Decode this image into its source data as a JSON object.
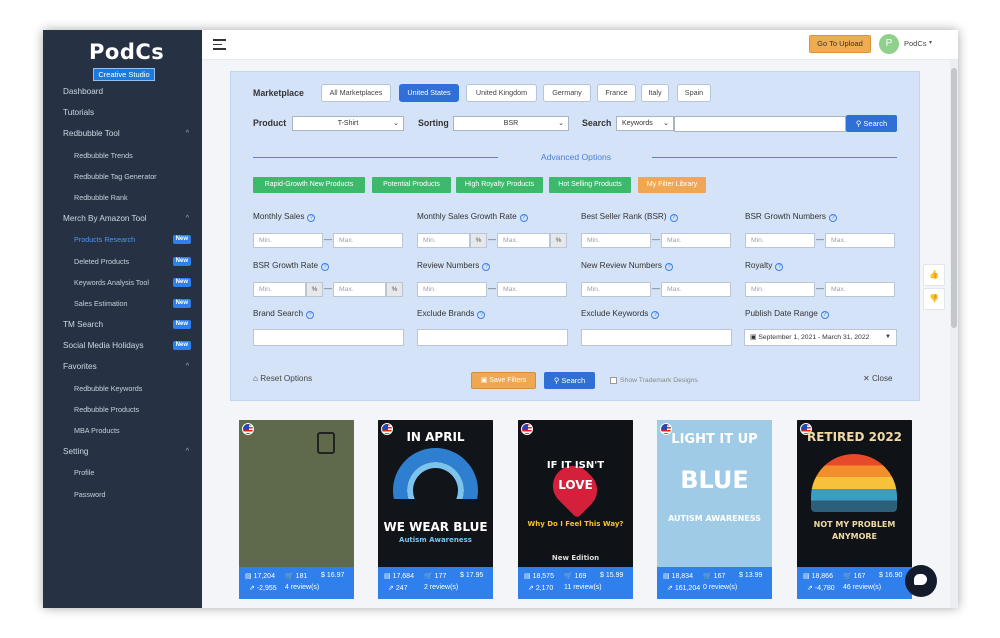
{
  "brand": {
    "title": "PodCs",
    "subtitle": "Creative Studio"
  },
  "sidebar": {
    "items": [
      {
        "label": "Dashboard",
        "level": "top"
      },
      {
        "label": "Tutorials",
        "level": "top"
      },
      {
        "label": "Redbubble Tool",
        "level": "top",
        "chevron": "^"
      },
      {
        "label": "Redbubble Trends",
        "level": "sub"
      },
      {
        "label": "Redbubble Tag Generator",
        "level": "sub"
      },
      {
        "label": "Redbubble Rank",
        "level": "sub"
      },
      {
        "label": "Merch By Amazon Tool",
        "level": "top",
        "chevron": "^"
      },
      {
        "label": "Products Research",
        "level": "sub",
        "badge": "New",
        "active": true
      },
      {
        "label": "Deleted Products",
        "level": "sub",
        "badge": "New"
      },
      {
        "label": "Keywords Analysis Tool",
        "level": "sub",
        "badge": "New"
      },
      {
        "label": "Sales Estimation",
        "level": "sub",
        "badge": "New"
      },
      {
        "label": "TM Search",
        "level": "top",
        "badge": "New"
      },
      {
        "label": "Social Media Holidays",
        "level": "top",
        "badge": "New"
      },
      {
        "label": "Favorites",
        "level": "top",
        "chevron": "^"
      },
      {
        "label": "Redbubble Keywords",
        "level": "sub"
      },
      {
        "label": "Redbubble Products",
        "level": "sub"
      },
      {
        "label": "MBA Products",
        "level": "sub"
      },
      {
        "label": "Setting",
        "level": "top",
        "chevron": "^"
      },
      {
        "label": "Profile",
        "level": "sub"
      },
      {
        "label": "Password",
        "level": "sub"
      }
    ]
  },
  "header": {
    "upload_label": "Go To Upload",
    "avatar_letter": "P",
    "user_name": "PodCs",
    "user_caret": "▾"
  },
  "filters": {
    "marketplace_label": "Marketplace",
    "marketplaces": [
      "All Marketplaces",
      "United States",
      "United Kingdom",
      "Germany",
      "France",
      "Italy",
      "Spain"
    ],
    "active_marketplace": "United States",
    "product_label": "Product",
    "product_value": "T-Shirt",
    "sorting_label": "Sorting",
    "sorting_value": "BSR",
    "search_label": "Search",
    "search_type": "Keywords",
    "search_button": "Search",
    "advanced_label": "Advanced Options",
    "quick_tags": [
      "Rapid-Growth New Products",
      "Potential Products",
      "High Royalty Products",
      "Hot Selling Products",
      "My Filter Library"
    ],
    "min_placeholder": "Min.",
    "max_placeholder": "Max.",
    "percent": "%",
    "range_sep": "—",
    "fields": {
      "monthly_sales": "Monthly Sales",
      "monthly_sales_growth": "Monthly Sales Growth Rate",
      "bsr": "Best Seller Rank (BSR)",
      "bsr_growth_numbers": "BSR Growth Numbers",
      "bsr_growth_rate": "BSR Growth Rate",
      "review_numbers": "Review Numbers",
      "new_review_numbers": "New Review Numbers",
      "royalty": "Royalty",
      "brand_search": "Brand Search",
      "exclude_brands": "Exclude Brands",
      "exclude_keywords": "Exclude Keywords",
      "publish_date_range": "Publish Date Range"
    },
    "date_range_value": "September 1, 2021 - March 31, 2022",
    "reset_label": "Reset Options",
    "save_label": "Save Filters",
    "search2_label": "Search",
    "show_tm_label": "Show Trademark Designs",
    "close_label": "Close"
  },
  "products": [
    {
      "bsr": "17,204",
      "sales": "181",
      "price": "$ 16.97",
      "growth": "-2,955",
      "reviews": "4 review(s)",
      "bg": "#5f6a4a",
      "text1": "",
      "text2": ""
    },
    {
      "bsr": "17,684",
      "sales": "177",
      "price": "$ 17.95",
      "growth": "247",
      "reviews": "2 review(s)",
      "bg": "#111418",
      "text1": "IN APRIL",
      "text2": "WE WEAR BLUE",
      "text3": "Autism Awareness"
    },
    {
      "bsr": "18,575",
      "sales": "169",
      "price": "$ 15.99",
      "growth": "2,170",
      "reviews": "11 review(s)",
      "bg": "#0f1216",
      "text1": "IF IT ISN'T",
      "text2": "LOVE",
      "text3": "Why Do I Feel This Way?",
      "text4": "New Edition"
    },
    {
      "bsr": "18,834",
      "sales": "167",
      "price": "$ 13.99",
      "growth": "161,204",
      "reviews": "0 review(s)",
      "bg": "#9fcbe6",
      "text1": "LIGHT IT UP",
      "text2": "BLUE",
      "text3": "AUTISM AWARENESS"
    },
    {
      "bsr": "18,866",
      "sales": "167",
      "price": "$ 16.90",
      "growth": "-4,780",
      "reviews": "46 review(s)",
      "bg": "#0f1216",
      "text1": "RETIRED 2022",
      "text2": "NOT MY PROBLEM",
      "text3": "ANYMORE"
    }
  ]
}
